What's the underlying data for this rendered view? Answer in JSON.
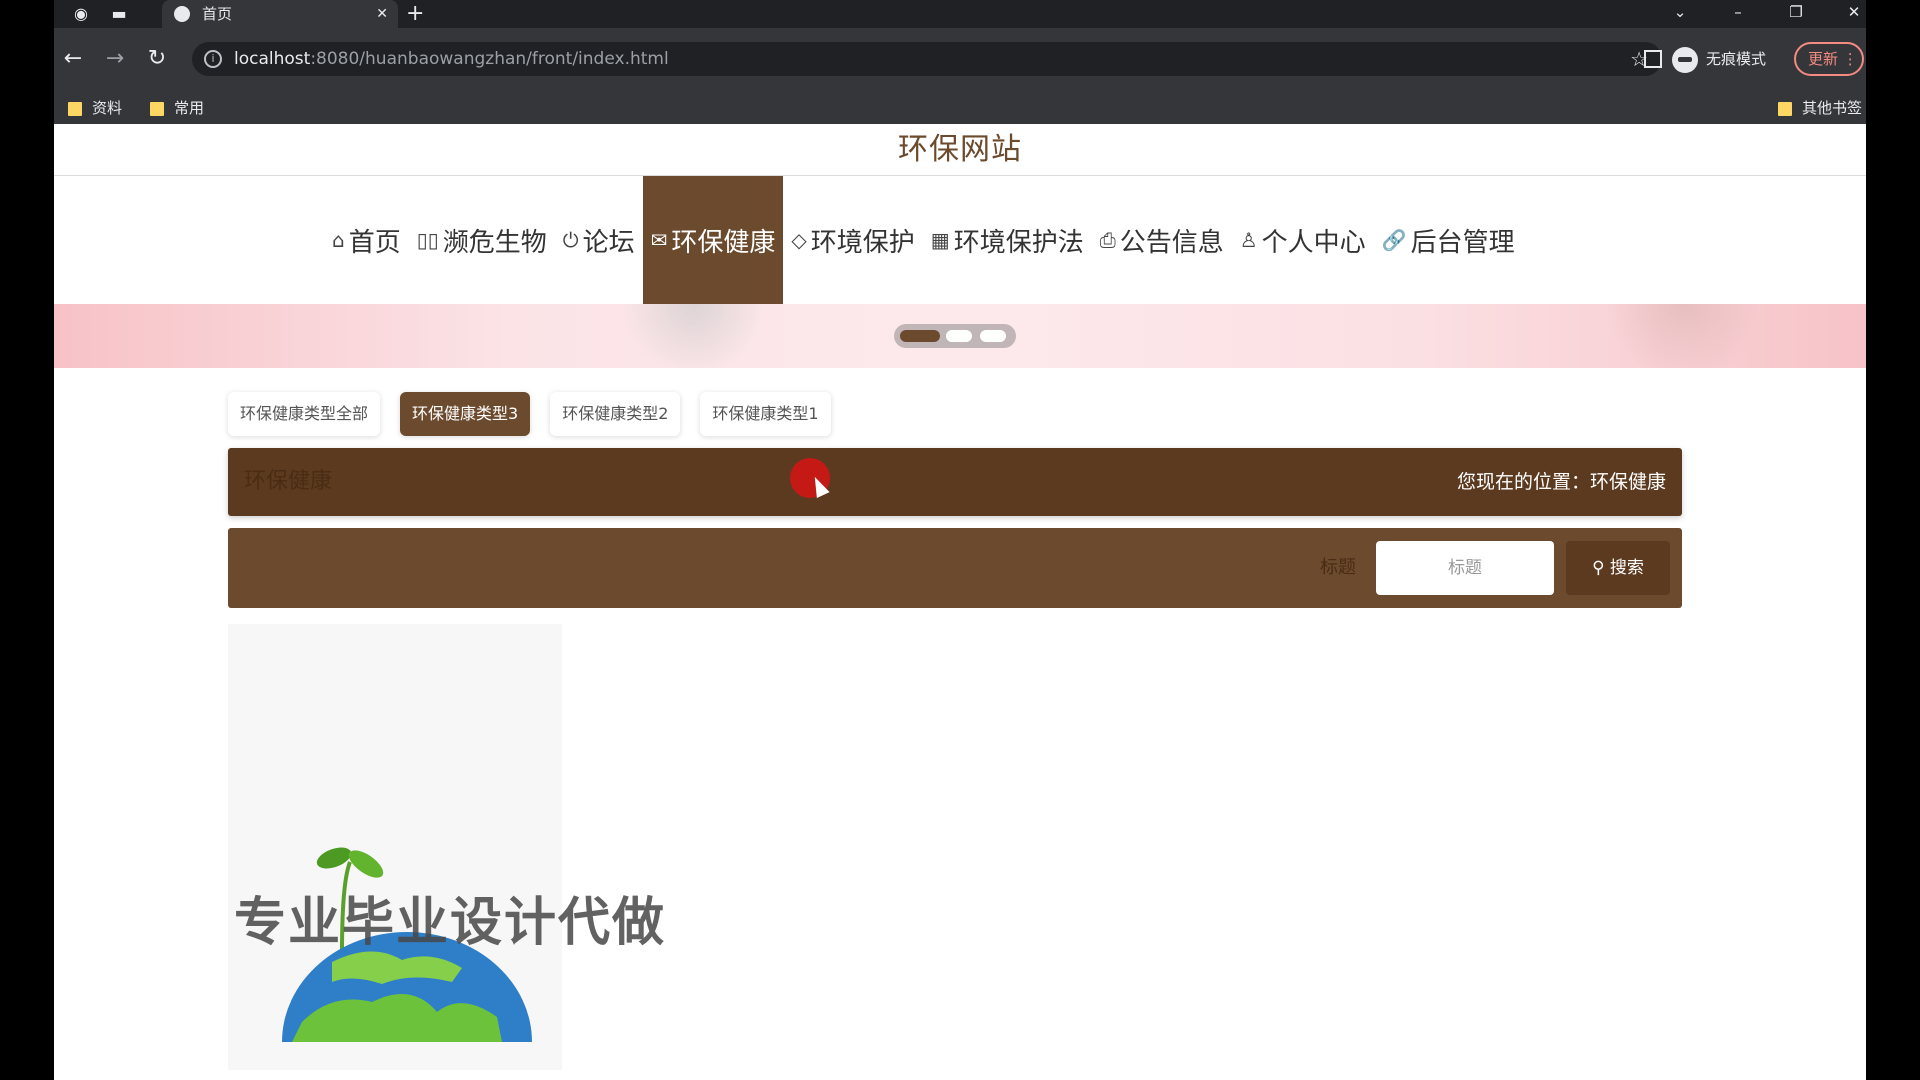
{
  "browser": {
    "tab_title": "首页",
    "url_host": "localhost",
    "url_path": ":8080/huanbaowangzhan/front/index.html",
    "incognito_label": "无痕模式",
    "update_label": "更新",
    "bookmarks": [
      "资料",
      "常用"
    ],
    "other_bookmarks": "其他书签"
  },
  "site": {
    "title": "环保网站"
  },
  "nav": {
    "items": [
      {
        "label": "首页",
        "icon": "home-icon",
        "glyph": "⌂"
      },
      {
        "label": "濒危生物",
        "icon": "book-icon",
        "glyph": "▯▯"
      },
      {
        "label": "论坛",
        "icon": "power-icon",
        "glyph": "⏻"
      },
      {
        "label": "环保健康",
        "icon": "mail-icon",
        "glyph": "✉"
      },
      {
        "label": "环境保护",
        "icon": "tag-icon",
        "glyph": "◇"
      },
      {
        "label": "环境保护法",
        "icon": "grid-icon",
        "glyph": "▦"
      },
      {
        "label": "公告信息",
        "icon": "print-icon",
        "glyph": "⎙"
      },
      {
        "label": "个人中心",
        "icon": "user-icon",
        "glyph": "♙"
      },
      {
        "label": "后台管理",
        "icon": "link-icon",
        "glyph": "🔗"
      }
    ],
    "active_index": 3,
    "active_color": "#6b4a2e"
  },
  "carousel": {
    "active_index": 0,
    "dot_count": 3
  },
  "categories": {
    "items": [
      "环保健康类型全部",
      "环保健康类型3",
      "环保健康类型2",
      "环保健康类型1"
    ],
    "active_index": 1
  },
  "breadcrumb": {
    "title": "环保健康",
    "position_label": "您现在的位置：",
    "position_value": "环保健康",
    "position_text": "您现在的位置：环保健康"
  },
  "search": {
    "label": "标题",
    "placeholder": "标题",
    "button_label": "搜索"
  },
  "content": {
    "watermark": "专业毕业设计代做"
  },
  "colors": {
    "brand_brown": "#6b4a2e",
    "dark_brown": "#5c3a1f"
  }
}
